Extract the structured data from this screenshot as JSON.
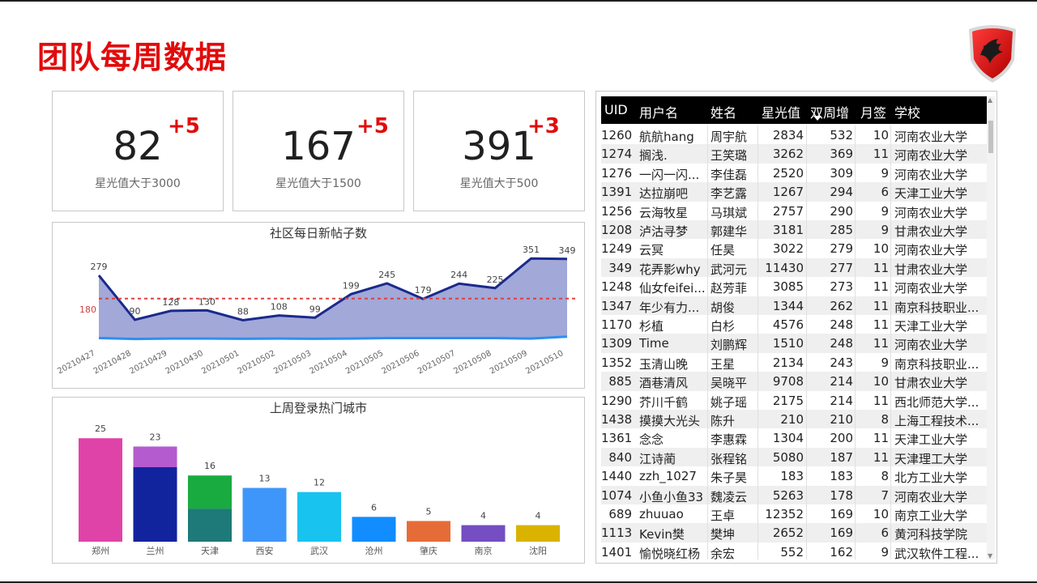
{
  "page_title": "团队每周数据",
  "kpis": [
    {
      "value": "82",
      "delta": "+5",
      "label": "星光值大于3000"
    },
    {
      "value": "167",
      "delta": "+5",
      "label": "星光值大于1500"
    },
    {
      "value": "391",
      "delta": "+3",
      "label": "星光值大于500"
    }
  ],
  "colors": {
    "title_red": "#e10b0b",
    "line_dark": "#1a2a8c",
    "area_fill": "#a2a8d8",
    "base_line": "#2d8ff0",
    "ref_line": "#e0403a"
  },
  "chart_data": [
    {
      "type": "area",
      "title": "社区每日新帖子数",
      "categories": [
        "20210427",
        "20210428",
        "20210429",
        "20210430",
        "20210501",
        "20210502",
        "20210503",
        "20210504",
        "20210505",
        "20210506",
        "20210507",
        "20210508",
        "20210509",
        "20210510"
      ],
      "series": [
        {
          "values": [
            279,
            90,
            128,
            130,
            88,
            108,
            99,
            199,
            245,
            179,
            244,
            225,
            351,
            349
          ]
        },
        {
          "values": [
            12,
            8,
            10,
            10,
            9,
            10,
            9,
            10,
            12,
            12,
            12,
            12,
            10,
            18
          ]
        }
      ],
      "reference_line": {
        "value": 180,
        "label": "180"
      },
      "data_labels": [
        "279",
        "90",
        "128",
        "130",
        "88",
        "108",
        "99",
        "199",
        "245",
        "179",
        "244",
        "225",
        "351",
        "349"
      ],
      "ylim": [
        0,
        400
      ],
      "grid": false
    },
    {
      "type": "bar",
      "title": "上周登录热门城市",
      "categories": [
        "郑州",
        "兰州",
        "天津",
        "西安",
        "武汉",
        "沧州",
        "肇庆",
        "南京",
        "沈阳"
      ],
      "totals": [
        25,
        23,
        16,
        13,
        12,
        6,
        5,
        4,
        4
      ],
      "total_labels": [
        "25",
        "23",
        "16",
        "13",
        "12",
        "6",
        "5",
        "4",
        "4"
      ],
      "stacked": [
        {
          "city": "郑州",
          "segments": [
            {
              "value": 25,
              "color": "#e043a8"
            }
          ]
        },
        {
          "city": "兰州",
          "segments": [
            {
              "value": 18,
              "color": "#12239e"
            },
            {
              "value": 5,
              "color": "#b45bd0"
            }
          ]
        },
        {
          "city": "天津",
          "segments": [
            {
              "value": 8,
              "color": "#1e7a78"
            },
            {
              "value": 8,
              "color": "#1aab40"
            }
          ]
        },
        {
          "city": "西安",
          "segments": [
            {
              "value": 13,
              "color": "#3f96fa"
            }
          ]
        },
        {
          "city": "武汉",
          "segments": [
            {
              "value": 12,
              "color": "#18c3f0"
            }
          ]
        },
        {
          "city": "沧州",
          "segments": [
            {
              "value": 6,
              "color": "#118dff"
            }
          ]
        },
        {
          "city": "肇庆",
          "segments": [
            {
              "value": 5,
              "color": "#e66c37"
            }
          ]
        },
        {
          "city": "南京",
          "segments": [
            {
              "value": 4,
              "color": "#744ec2"
            }
          ]
        },
        {
          "city": "沈阳",
          "segments": [
            {
              "value": 4,
              "color": "#d9b300"
            }
          ]
        }
      ],
      "ylim": [
        0,
        27
      ]
    }
  ],
  "table": {
    "columns": [
      "UID",
      "用户名",
      "姓名",
      "星光值",
      "双周增",
      "月签",
      "学校"
    ],
    "sort_column": "双周增",
    "rows": [
      [
        "1260",
        "航航hang",
        "周宇航",
        "2834",
        "532",
        "10",
        "河南农业大学"
      ],
      [
        "1274",
        "搁浅.",
        "王笑璐",
        "3262",
        "369",
        "11",
        "河南农业大学"
      ],
      [
        "1276",
        "一闪一闪...",
        "李佳磊",
        "2520",
        "309",
        "9",
        "河南农业大学"
      ],
      [
        "1391",
        "达拉崩吧",
        "李艺露",
        "1267",
        "294",
        "6",
        "天津工业大学"
      ],
      [
        "1256",
        "云海牧星",
        "马琪斌",
        "2757",
        "290",
        "9",
        "河南农业大学"
      ],
      [
        "1208",
        "泸沽寻梦",
        "郭建华",
        "3181",
        "285",
        "9",
        "甘肃农业大学"
      ],
      [
        "1249",
        "云冥",
        "任昊",
        "3022",
        "279",
        "10",
        "河南农业大学"
      ],
      [
        "349",
        "花弄影why",
        "武河元",
        "11430",
        "277",
        "11",
        "甘肃农业大学"
      ],
      [
        "1248",
        "仙女feifei...",
        "赵芳菲",
        "3085",
        "273",
        "11",
        "河南农业大学"
      ],
      [
        "1347",
        "年少有力...",
        "胡俊",
        "1344",
        "262",
        "11",
        "南京科技职业..."
      ],
      [
        "1170",
        "杉植",
        "白杉",
        "4576",
        "248",
        "11",
        "天津工业大学"
      ],
      [
        "1309",
        "Time",
        "刘鹏辉",
        "1510",
        "248",
        "11",
        "河南农业大学"
      ],
      [
        "1352",
        "玉清山晚",
        "王星",
        "2134",
        "243",
        "9",
        "南京科技职业..."
      ],
      [
        "885",
        "酒巷清风",
        "吴晓平",
        "9708",
        "214",
        "10",
        "甘肃农业大学"
      ],
      [
        "1290",
        "芥川千鹤",
        "姚子瑶",
        "2175",
        "214",
        "11",
        "西北师范大学..."
      ],
      [
        "1438",
        "摸摸大光头",
        "陈升",
        "210",
        "210",
        "8",
        "上海工程技术..."
      ],
      [
        "1361",
        "念念",
        "李惠霖",
        "1304",
        "200",
        "11",
        "天津工业大学"
      ],
      [
        "840",
        "江诗蔺",
        "张程铭",
        "5080",
        "187",
        "11",
        "天津理工大学"
      ],
      [
        "1440",
        "zzh_1027",
        "朱子昊",
        "183",
        "183",
        "8",
        "北方工业大学"
      ],
      [
        "1074",
        "小鱼小鱼33",
        "魏凌云",
        "5263",
        "178",
        "7",
        "河南农业大学"
      ],
      [
        "689",
        "zhuuao",
        "王卓",
        "12352",
        "169",
        "10",
        "南京工业大学"
      ],
      [
        "1113",
        "Kevin樊",
        "樊坤",
        "2652",
        "169",
        "6",
        "黄河科技学院"
      ],
      [
        "1401",
        "愉悦晓红杨",
        "余宏",
        "552",
        "162",
        "9",
        "武汉软件工程..."
      ]
    ]
  }
}
